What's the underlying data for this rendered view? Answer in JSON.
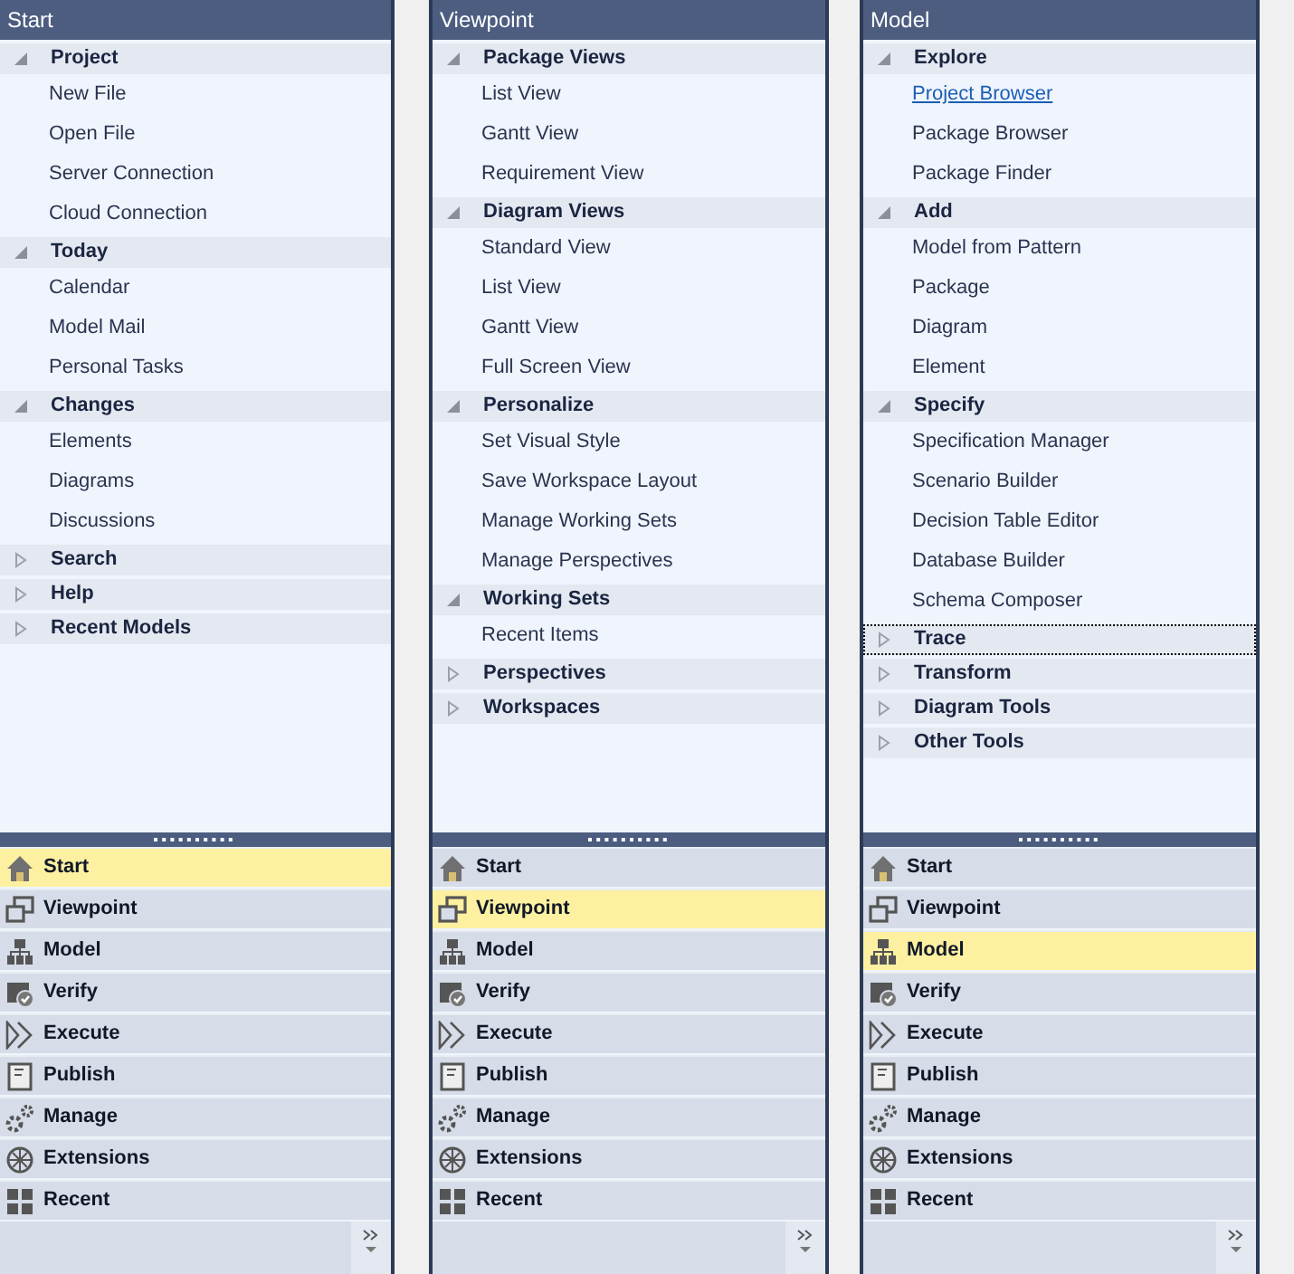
{
  "panels": [
    {
      "title": "Start",
      "groups": [
        {
          "label": "Project",
          "expanded": true,
          "focused": false,
          "items": [
            {
              "label": "New File",
              "kind": "plain"
            },
            {
              "label": "Open File",
              "kind": "plain"
            },
            {
              "label": "Server Connection",
              "kind": "plain"
            },
            {
              "label": "Cloud Connection",
              "kind": "plain"
            }
          ]
        },
        {
          "label": "Today",
          "expanded": true,
          "focused": false,
          "items": [
            {
              "label": "Calendar",
              "kind": "plain"
            },
            {
              "label": "Model Mail",
              "kind": "plain"
            },
            {
              "label": "Personal Tasks",
              "kind": "plain"
            }
          ]
        },
        {
          "label": "Changes",
          "expanded": true,
          "focused": false,
          "items": [
            {
              "label": "Elements",
              "kind": "plain"
            },
            {
              "label": "Diagrams",
              "kind": "plain"
            },
            {
              "label": "Discussions",
              "kind": "plain"
            }
          ]
        },
        {
          "label": "Search",
          "expanded": false,
          "focused": false
        },
        {
          "label": "Help",
          "expanded": false,
          "focused": false
        },
        {
          "label": "Recent Models",
          "expanded": false,
          "focused": false
        }
      ],
      "nav": [
        {
          "label": "Start",
          "selected": true
        },
        {
          "label": "Viewpoint",
          "selected": false
        },
        {
          "label": "Model",
          "selected": false
        },
        {
          "label": "Verify",
          "selected": false
        },
        {
          "label": "Execute",
          "selected": false
        },
        {
          "label": "Publish",
          "selected": false
        },
        {
          "label": "Manage",
          "selected": false
        },
        {
          "label": "Extensions",
          "selected": false
        },
        {
          "label": "Recent",
          "selected": false
        }
      ]
    },
    {
      "title": "Viewpoint",
      "groups": [
        {
          "label": "Package Views",
          "expanded": true,
          "focused": false,
          "items": [
            {
              "label": "List View",
              "kind": "plain"
            },
            {
              "label": "Gantt View",
              "kind": "plain"
            },
            {
              "label": "Requirement View",
              "kind": "plain"
            }
          ]
        },
        {
          "label": "Diagram Views",
          "expanded": true,
          "focused": false,
          "items": [
            {
              "label": "Standard View",
              "kind": "plain"
            },
            {
              "label": "List View",
              "kind": "plain"
            },
            {
              "label": "Gantt View",
              "kind": "plain"
            },
            {
              "label": "Full Screen View",
              "kind": "plain"
            }
          ]
        },
        {
          "label": "Personalize",
          "expanded": true,
          "focused": false,
          "items": [
            {
              "label": "Set Visual Style",
              "kind": "plain"
            },
            {
              "label": "Save Workspace Layout",
              "kind": "plain"
            },
            {
              "label": "Manage Working Sets",
              "kind": "plain"
            },
            {
              "label": "Manage Perspectives",
              "kind": "plain"
            }
          ]
        },
        {
          "label": "Working Sets",
          "expanded": true,
          "focused": false,
          "items": [
            {
              "label": "Recent Items",
              "kind": "plain"
            }
          ]
        },
        {
          "label": "Perspectives",
          "expanded": false,
          "focused": false
        },
        {
          "label": "Workspaces",
          "expanded": false,
          "focused": false
        }
      ],
      "nav": [
        {
          "label": "Start",
          "selected": false
        },
        {
          "label": "Viewpoint",
          "selected": true
        },
        {
          "label": "Model",
          "selected": false
        },
        {
          "label": "Verify",
          "selected": false
        },
        {
          "label": "Execute",
          "selected": false
        },
        {
          "label": "Publish",
          "selected": false
        },
        {
          "label": "Manage",
          "selected": false
        },
        {
          "label": "Extensions",
          "selected": false
        },
        {
          "label": "Recent",
          "selected": false
        }
      ]
    },
    {
      "title": "Model",
      "groups": [
        {
          "label": "Explore",
          "expanded": true,
          "focused": false,
          "items": [
            {
              "label": "Project Browser",
              "kind": "link"
            },
            {
              "label": "Package Browser",
              "kind": "plain"
            },
            {
              "label": "Package Finder",
              "kind": "plain"
            }
          ]
        },
        {
          "label": "Add",
          "expanded": true,
          "focused": false,
          "items": [
            {
              "label": "Model from Pattern",
              "kind": "plain"
            },
            {
              "label": "Package",
              "kind": "plain"
            },
            {
              "label": "Diagram",
              "kind": "plain"
            },
            {
              "label": "Element",
              "kind": "plain"
            }
          ]
        },
        {
          "label": "Specify",
          "expanded": true,
          "focused": false,
          "items": [
            {
              "label": "Specification Manager",
              "kind": "plain"
            },
            {
              "label": "Scenario Builder",
              "kind": "plain"
            },
            {
              "label": "Decision Table Editor",
              "kind": "plain"
            },
            {
              "label": "Database Builder",
              "kind": "plain"
            },
            {
              "label": "Schema Composer",
              "kind": "plain"
            }
          ]
        },
        {
          "label": "Trace",
          "expanded": false,
          "focused": true
        },
        {
          "label": "Transform",
          "expanded": false,
          "focused": false
        },
        {
          "label": "Diagram Tools",
          "expanded": false,
          "focused": false
        },
        {
          "label": "Other Tools",
          "expanded": false,
          "focused": false
        }
      ],
      "nav": [
        {
          "label": "Start",
          "selected": false
        },
        {
          "label": "Viewpoint",
          "selected": false
        },
        {
          "label": "Model",
          "selected": true
        },
        {
          "label": "Verify",
          "selected": false
        },
        {
          "label": "Execute",
          "selected": false
        },
        {
          "label": "Publish",
          "selected": false
        },
        {
          "label": "Manage",
          "selected": false
        },
        {
          "label": "Extensions",
          "selected": false
        },
        {
          "label": "Recent",
          "selected": false
        }
      ]
    }
  ]
}
